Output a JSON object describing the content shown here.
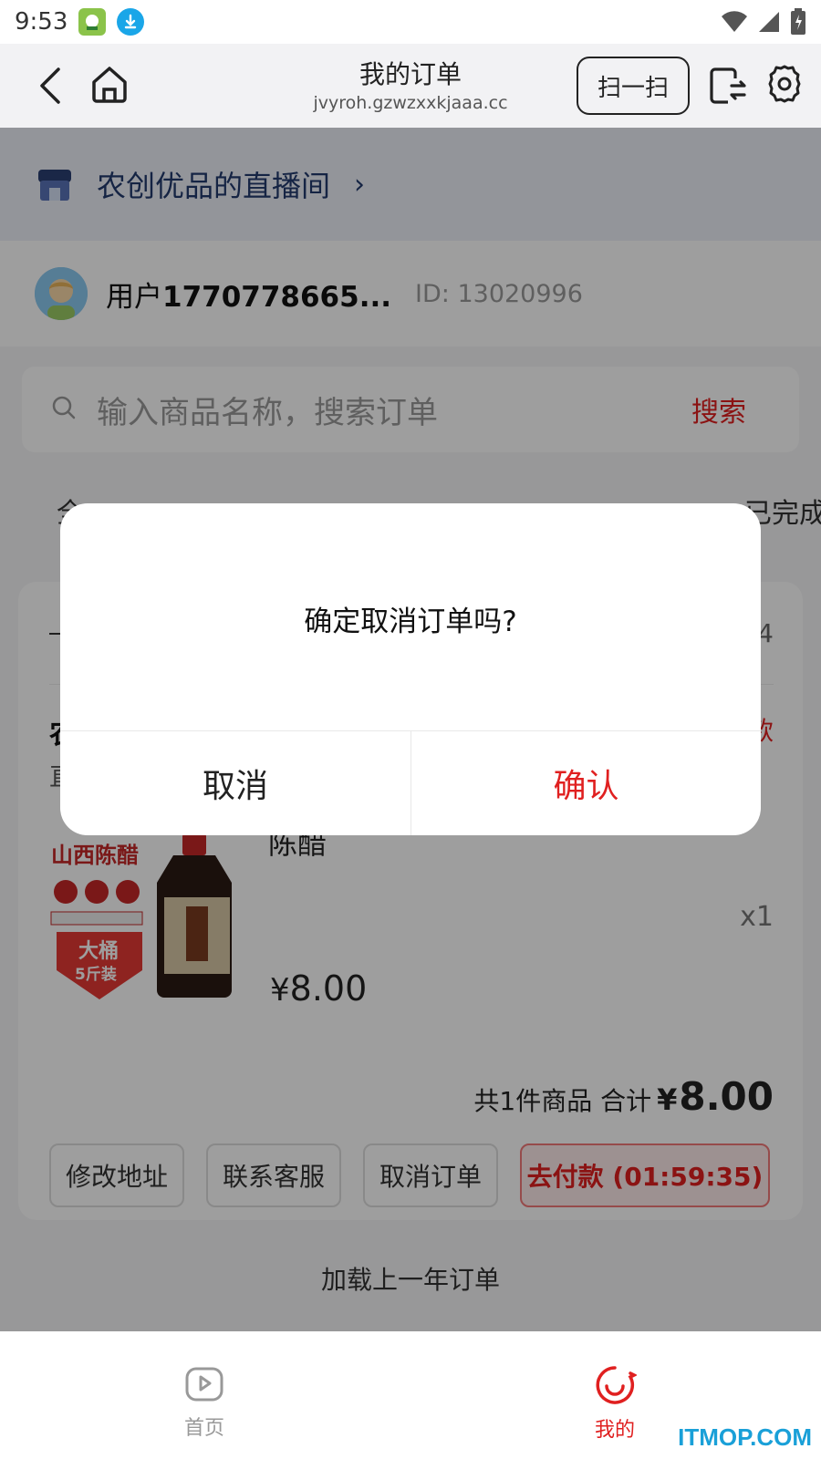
{
  "status_bar": {
    "time": "9:53"
  },
  "title_bar": {
    "title": "我的订单",
    "url": "jvyroh.gzwzxxkjaaa.cc",
    "scan_label": "扫一扫"
  },
  "store": {
    "name": "农创优品的直播间"
  },
  "user": {
    "name_prefix": "用户",
    "name_number": "1770778665...",
    "id": "ID: 13020996"
  },
  "search": {
    "placeholder": "输入商品名称，搜索订单",
    "button": "搜索"
  },
  "tabs": {
    "left_partial": "全",
    "right_partial": "已完成"
  },
  "order": {
    "number_partial": "4",
    "store_partial": "农",
    "status_partial": "款",
    "sub_partial": "直",
    "product_name": "陈醋",
    "quantity": "x1",
    "price_symbol": "¥",
    "price": "8.00",
    "product_image_texts": [
      "山西陈醋",
      "大桶",
      "5斤装"
    ],
    "total_prefix": "共1件商品 合计",
    "total_symbol": "¥",
    "total": "8.00",
    "buttons": {
      "edit_address": "修改地址",
      "contact_service": "联系客服",
      "cancel_order": "取消订单",
      "pay": "去付款 (01:59:35)"
    }
  },
  "load_more": "加载上一年订单",
  "dialog": {
    "message": "确定取消订单吗?",
    "cancel": "取消",
    "confirm": "确认"
  },
  "bottom_nav": {
    "home": "首页",
    "mine": "我的"
  },
  "watermark": "ITMOP.COM",
  "colors": {
    "accent": "#e02020",
    "store_text": "#223a6e",
    "overlay": "rgba(0,0,0,0.38)"
  }
}
